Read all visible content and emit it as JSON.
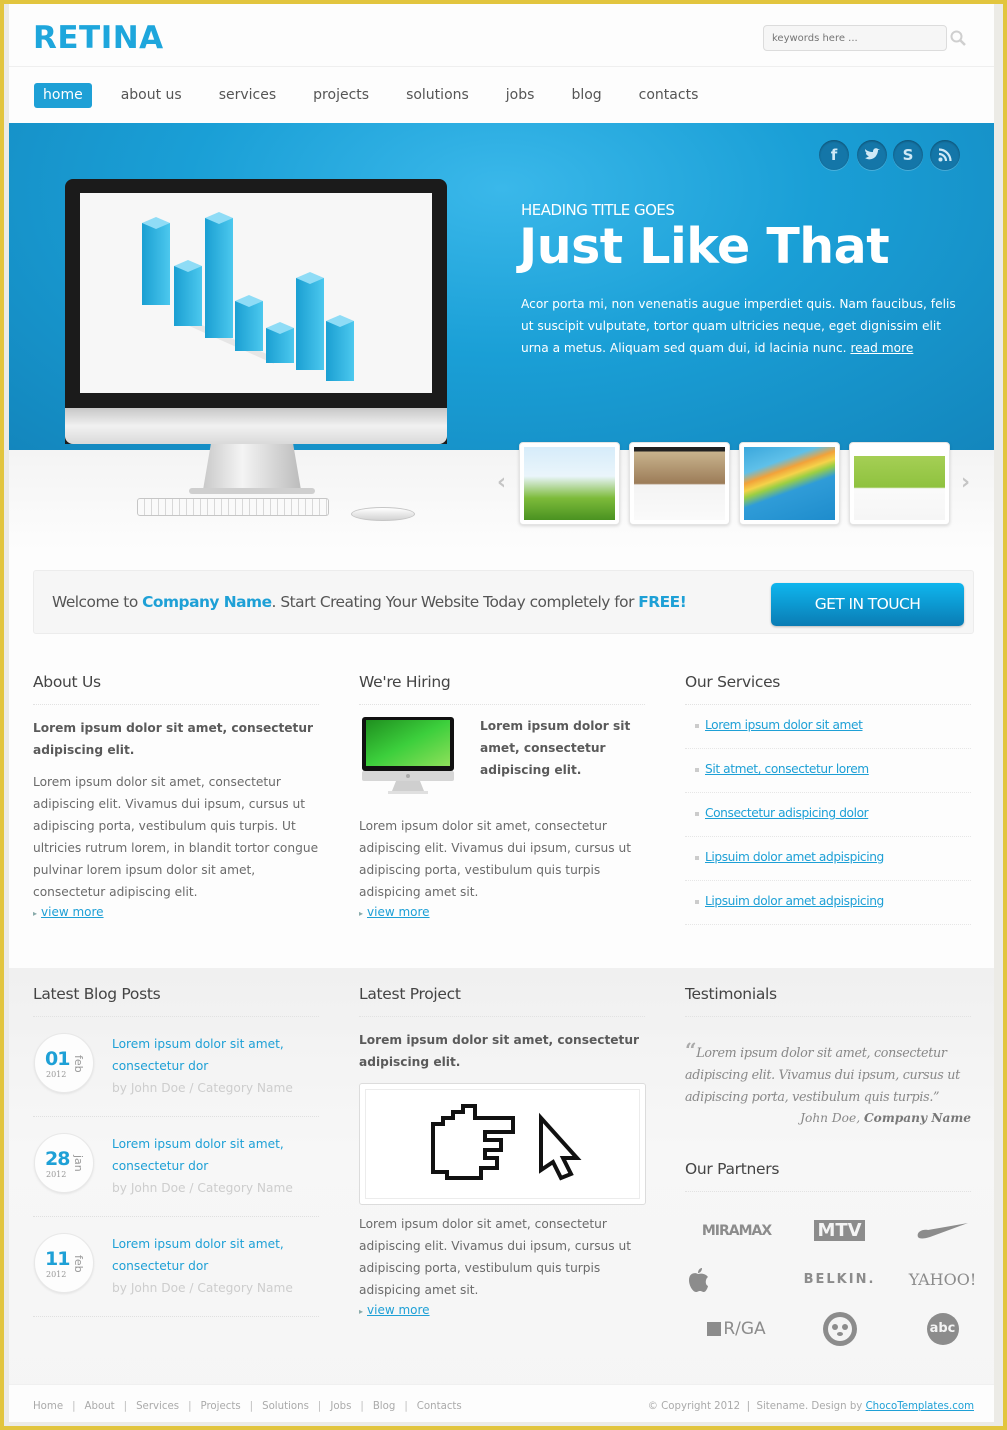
{
  "site": {
    "logo": "RETINA"
  },
  "search": {
    "placeholder": "keywords here ..."
  },
  "nav": {
    "items": [
      {
        "label": "home",
        "active": true
      },
      {
        "label": "about us"
      },
      {
        "label": "services"
      },
      {
        "label": "projects"
      },
      {
        "label": "solutions"
      },
      {
        "label": "jobs"
      },
      {
        "label": "blog"
      },
      {
        "label": "contacts"
      }
    ]
  },
  "hero": {
    "kicker": "HEADING TITLE GOES",
    "title": "Just Like That",
    "text": "Acor porta mi, non venenatis augue imperdiet quis. Nam faucibus, felis ut suscipit vulputate, tortor quam ultricies neque, eget dignissim elit urna a metus. Aliquam sed quam dui, id lacinia nunc.",
    "read_more": "read more",
    "social": [
      {
        "icon": "facebook-icon",
        "glyph": "f"
      },
      {
        "icon": "twitter-icon",
        "glyph": "t"
      },
      {
        "icon": "skype-icon",
        "glyph": "S"
      },
      {
        "icon": "rss-icon",
        "glyph": "☰"
      }
    ],
    "thumbnails": [
      "Creative design template",
      "Interior template",
      "Colorful waves template",
      "Mobile app template"
    ],
    "prev_glyph": "‹",
    "next_glyph": "›"
  },
  "welcome": {
    "prefix": "Welcome to ",
    "company": "Company Name",
    "middle": ". Start Creating Your Website Today completely for ",
    "free": "FREE!",
    "cta": "GET IN TOUCH"
  },
  "about": {
    "title": "About Us",
    "lead": "Lorem ipsum dolor sit amet, consectetur adipiscing elit.",
    "body": "Lorem ipsum dolor sit amet, consectetur adipiscing elit. Vivamus dui ipsum, cursus ut adipiscing porta, vestibulum quis turpis. Ut ultricies rutrum lorem, in blandit tortor congue pulvinar lorem ipsum dolor sit amet, consectetur adipiscing elit.",
    "more": "view more"
  },
  "hiring": {
    "title": "We're Hiring",
    "lead": "Lorem ipsum dolor sit amet, consectetur adipiscing elit.",
    "body": "Lorem ipsum dolor sit amet, consectetur adipiscing elit. Vivamus dui ipsum, cursus ut adipiscing porta, vestibulum quis turpis adispicing amet sit.",
    "more": "view more"
  },
  "services": {
    "title": "Our Services",
    "items": [
      "Lorem ipsum dolor sit amet",
      "Sit atmet, consectetur lorem",
      "Consectetur adispicing dolor",
      "Lipsuim dolor amet adpispicing",
      "Lipsuim dolor amet adpispicing"
    ]
  },
  "blog": {
    "title": "Latest Blog Posts",
    "posts": [
      {
        "day": "01",
        "month": "feb",
        "year": "2012",
        "title": "Lorem ipsum dolor sit amet, consectetur dor",
        "meta": "by John Doe / Category Name"
      },
      {
        "day": "28",
        "month": "jan",
        "year": "2012",
        "title": "Lorem ipsum dolor sit amet, consectetur dor",
        "meta": "by John Doe / Category Name"
      },
      {
        "day": "11",
        "month": "feb",
        "year": "2012",
        "title": "Lorem ipsum dolor sit amet, consectetur dor",
        "meta": "by John Doe / Category Name"
      }
    ]
  },
  "project": {
    "title": "Latest Project",
    "lead": "Lorem ipsum dolor sit amet, consectetur adipiscing elit.",
    "body": "Lorem ipsum dolor sit amet, consectetur adipiscing elit. Vivamus dui ipsum, cursus ut adipiscing porta, vestibulum quis turpis adispicing amet sit.",
    "more": "view more"
  },
  "testimonials": {
    "title": "Testimonials",
    "quote": "Lorem ipsum dolor sit amet, consectetur adipiscing elit. Vivamus dui ipsum, cursus ut adipiscing porta, vestibulum quis turpis.”",
    "author": "John Doe, ",
    "company": "Company Name"
  },
  "partners": {
    "title": "Our Partners",
    "items": [
      "MIRAMAX",
      "MTV",
      "Nike",
      "Apple",
      "BELKIN.",
      "YAHOO!",
      "R/GA",
      "WWF",
      "abc"
    ]
  },
  "footer": {
    "links": [
      "Home",
      "About",
      "Services",
      "Projects",
      "Solutions",
      "Jobs",
      "Blog",
      "Contacts"
    ],
    "copyright": "© Copyright 2012  |  Sitename. Design by ",
    "designer": "ChocoTemplates.com"
  }
}
